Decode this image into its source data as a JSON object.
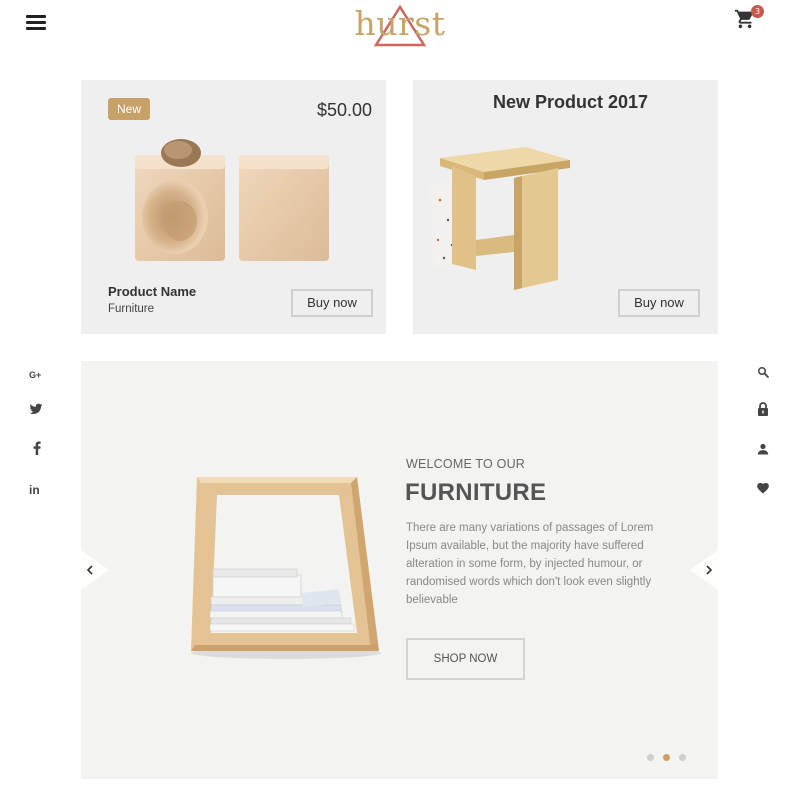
{
  "header": {
    "logo_text": "hurst",
    "cart_count": "3",
    "menu_icon": "hamburger-menu-icon",
    "cart_icon": "shopping-cart-icon"
  },
  "cards": [
    {
      "badge": "New",
      "price": "$50.00",
      "product_name": "Product Name",
      "category": "Furniture",
      "button": "Buy now"
    },
    {
      "title": "New Product 2017",
      "button": "Buy now"
    }
  ],
  "social_icons": [
    "google-plus-icon",
    "twitter-icon",
    "facebook-icon",
    "linkedin-icon"
  ],
  "social_glyphs": [
    "G+",
    "t",
    "f",
    "in"
  ],
  "utility_icons": [
    "search-icon",
    "lock-icon",
    "user-icon",
    "heart-icon"
  ],
  "hero": {
    "subtitle": "WELCOME TO OUR",
    "title": "FURNITURE",
    "description": "There are many variations of passages of Lorem Ipsum available, but the majority have suffered alteration in some form, by injected humour, or randomised words which don't look even slightly believable",
    "button": "SHOP NOW",
    "prev_icon": "chevron-left-icon",
    "next_icon": "chevron-right-icon",
    "slides": 3,
    "active_slide": 2
  },
  "colors": {
    "accent": "#c7a167",
    "badge_red": "#c9584c",
    "card_bg": "#efefef",
    "hero_bg": "#f3f3f1"
  }
}
